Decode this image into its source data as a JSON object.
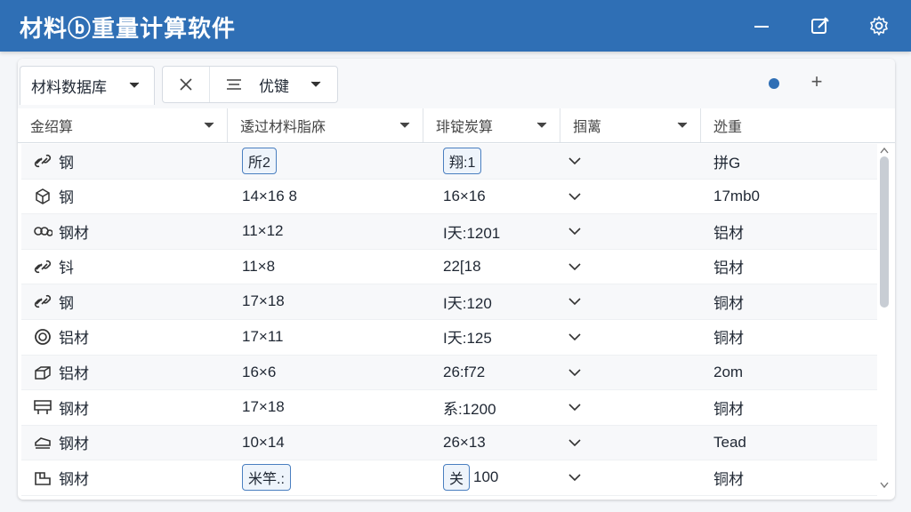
{
  "app": {
    "title": "材料ⓑ重量计算软件"
  },
  "toolbar": {
    "tab_label": "材料数据库",
    "sort_label": "优键"
  },
  "columns": [
    {
      "label": "金绍算"
    },
    {
      "label": "逶过材料脂庥"
    },
    {
      "label": "琲锭炭算"
    },
    {
      "label": "掴蓠"
    },
    {
      "label": "迯重"
    }
  ],
  "rows": [
    {
      "icon": "link-icon",
      "name": "钢",
      "dim": "所2",
      "dim_chip": true,
      "calc": "翔:1",
      "calc_chip": true,
      "calc_rest": "",
      "result": "拼G"
    },
    {
      "icon": "cube-icon",
      "name": "钢",
      "dim": "14×16 8",
      "dim_chip": false,
      "calc": "16×16",
      "calc_chip": false,
      "calc_rest": "",
      "result": "17mb0"
    },
    {
      "icon": "chain-icon",
      "name": "钢材",
      "dim": "11×12",
      "dim_chip": false,
      "calc": "I天:1201",
      "calc_chip": false,
      "calc_rest": "",
      "result": "铝材"
    },
    {
      "icon": "link-icon",
      "name": "钭",
      "dim": "11×8",
      "dim_chip": false,
      "calc": "22[18",
      "calc_chip": false,
      "calc_rest": "",
      "result": "铝材"
    },
    {
      "icon": "link-icon",
      "name": "钢",
      "dim": "17×18",
      "dim_chip": false,
      "calc": "I天:120",
      "calc_chip": false,
      "calc_rest": "",
      "result": "铜材"
    },
    {
      "icon": "ring-icon",
      "name": "铝材",
      "dim": "17×11",
      "dim_chip": false,
      "calc": "I天:125",
      "calc_chip": false,
      "calc_rest": "",
      "result": "铜材"
    },
    {
      "icon": "block-icon",
      "name": "铝材",
      "dim": "16×6",
      "dim_chip": false,
      "calc": "26:f72",
      "calc_chip": false,
      "calc_rest": "",
      "result": "2om"
    },
    {
      "icon": "frame-icon",
      "name": "钢材",
      "dim": "17×18",
      "dim_chip": false,
      "calc": "系:1200",
      "calc_chip": false,
      "calc_rest": "",
      "result": "铜材"
    },
    {
      "icon": "bar-icon",
      "name": "钢材",
      "dim": "10×14",
      "dim_chip": false,
      "calc": "26×13",
      "calc_chip": false,
      "calc_rest": "",
      "result": "Tead"
    },
    {
      "icon": "box-icon",
      "name": "钢材",
      "dim": "米竿.:",
      "dim_chip": true,
      "calc": "关",
      "calc_chip": true,
      "calc_rest": "100",
      "result": "铜材"
    }
  ],
  "colors": {
    "titlebar": "#2f6fb5",
    "accent_dot": "#2f6fb5",
    "chip_border": "#4a7fc0"
  }
}
